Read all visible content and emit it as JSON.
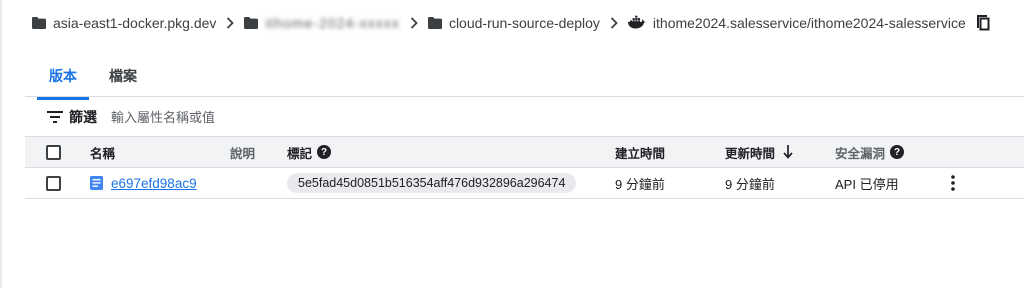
{
  "breadcrumb": {
    "items": [
      {
        "label": "asia-east1-docker.pkg.dev"
      },
      {
        "label": "ithome-2024-xxxxx"
      },
      {
        "label": "cloud-run-source-deploy"
      },
      {
        "label": "ithome2024.salesservice/ithome2024-salesservice"
      }
    ]
  },
  "tabs": [
    {
      "label": "版本"
    },
    {
      "label": "檔案"
    }
  ],
  "filter": {
    "label": "篩選",
    "placeholder": "輸入屬性名稱或值"
  },
  "table": {
    "headers": {
      "name": "名稱",
      "description": "說明",
      "tags": "標記",
      "created": "建立時間",
      "updated": "更新時間",
      "vulnerabilities": "安全漏洞"
    },
    "rows": [
      {
        "name": "e697efd98ac9",
        "description": "",
        "tag": "5e5fad45d0851b516354aff476d932896a296474",
        "created": "9 分鐘前",
        "updated": "9 分鐘前",
        "vulnerabilities": "API 已停用"
      }
    ]
  },
  "colors": {
    "accent": "#1a73e8",
    "header_bg": "#f1f3f4",
    "divider": "#dadce0"
  }
}
